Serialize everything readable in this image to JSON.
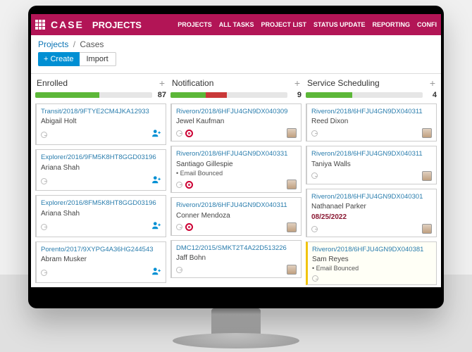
{
  "colors": {
    "brand": "#b21556",
    "accent_blue": "#008fd3",
    "link": "#0b74b5"
  },
  "topbar": {
    "brand": "CASE",
    "app_title": "PROJECTS",
    "nav": [
      "PROJECTS",
      "ALL TASKS",
      "PROJECT LIST",
      "STATUS UPDATE",
      "REPORTING",
      "CONFI"
    ]
  },
  "breadcrumb": {
    "root": "Projects",
    "current": "Cases"
  },
  "buttons": {
    "create": "+ Create",
    "import": "Import"
  },
  "columns": [
    {
      "title": "Enrolled",
      "count": 87,
      "progress": {
        "green_pct": 55,
        "red_pct": 0
      },
      "cards": [
        {
          "ref": "Transit/2018/9FTYE2CM4JKA12933",
          "name": "Abigail Holt",
          "right_icon": "person-add"
        },
        {
          "ref": "Explorer/2016/9FM5K8HT8GGD03196",
          "name": "Ariana Shah",
          "right_icon": "person-add"
        },
        {
          "ref": "Explorer/2016/8FM5K8HT8GGD03196",
          "name": "Ariana Shah",
          "right_icon": "person-add"
        },
        {
          "ref": "Porento/2017/9XYPG4A36HG244543",
          "name": "Abram Musker",
          "right_icon": "person-add"
        }
      ]
    },
    {
      "title": "Notification",
      "count": 9,
      "progress": {
        "green_pct": 30,
        "red_pct": 18
      },
      "cards": [
        {
          "ref": "Riveron/2018/6HFJU4GN9DX040309",
          "name": "Jewel Kaufman",
          "right_icon": "avatar",
          "target": true
        },
        {
          "ref": "Riveron/2018/6HFJU4GN9DX040331",
          "name": "Santiago Gillespie",
          "sub": "• Email Bounced",
          "right_icon": "avatar",
          "target": true
        },
        {
          "ref": "Riveron/2018/6HFJU4GN9DX040311",
          "name": "Conner Mendoza",
          "right_icon": "avatar",
          "target": true
        },
        {
          "ref": "DMC12/2015/SMKT2T4A22D513226",
          "name": "Jaff Bohn",
          "right_icon": "avatar"
        }
      ]
    },
    {
      "title": "Service Scheduling",
      "count": 4,
      "progress": {
        "green_pct": 40,
        "red_pct": 0
      },
      "cards": [
        {
          "ref": "Riveron/2018/6HFJU4GN9DX040311",
          "name": "Reed Dixon",
          "right_icon": "avatar"
        },
        {
          "ref": "Riveron/2018/6HFJU4GN9DX040311",
          "name": "Taniya Walls",
          "right_icon": "avatar"
        },
        {
          "ref": "Riveron/2018/6HFJU4GN9DX040301",
          "name": "Nathanael Parker",
          "date": "08/25/2022",
          "right_icon": "avatar"
        },
        {
          "ref": "Riveron/2018/6HFJU4GN9DX040381",
          "name": "Sam Reyes",
          "sub": "• Email Bounced",
          "yellow": true
        }
      ]
    }
  ]
}
